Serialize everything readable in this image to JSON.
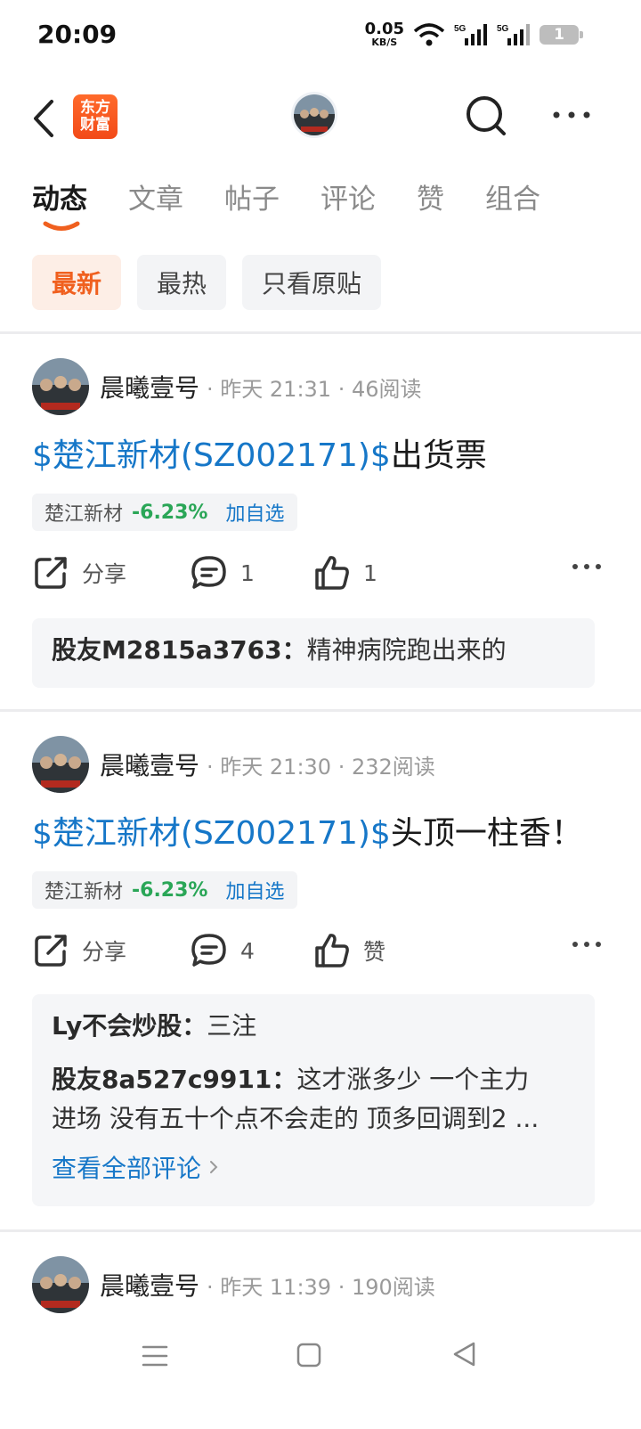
{
  "status_bar": {
    "time": "20:09",
    "net_speed": "0.05",
    "net_unit": "KB/S",
    "battery": "1",
    "signal_1": "5G",
    "signal_2": "5G"
  },
  "top_nav": {
    "logo_line1": "东方",
    "logo_line2": "财富"
  },
  "tabs": [
    "动态",
    "文章",
    "帖子",
    "评论",
    "赞",
    "组合"
  ],
  "filters": [
    "最新",
    "最热",
    "只看原贴"
  ],
  "posts": [
    {
      "author": "晨曦壹号",
      "meta": "· 昨天 21:31 · 46阅读",
      "stock_link": "$楚江新材(SZ002171)$",
      "text": "出货票",
      "stock_name": "楚江新材",
      "stock_change": "-6.23%",
      "add_watch": "加自选",
      "share_label": "分享",
      "comment_count": "1",
      "like_label": "1",
      "comments": [
        {
          "user": "股友M2815a3763：",
          "text": "精神病院跑出来的"
        }
      ]
    },
    {
      "author": "晨曦壹号",
      "meta": "· 昨天 21:30 · 232阅读",
      "stock_link": "$楚江新材(SZ002171)$",
      "text": "头顶一柱香！",
      "stock_name": "楚江新材",
      "stock_change": "-6.23%",
      "add_watch": "加自选",
      "share_label": "分享",
      "comment_count": "4",
      "like_label": "赞",
      "comments": [
        {
          "user": "Ly不会炒股：",
          "text": "三注"
        },
        {
          "user": "股友8a527c9911：",
          "text": "这才涨多少 一个主力",
          "text2": "进场 没有五十个点不会走的 顶多回调到2 ..."
        }
      ],
      "view_all": "查看全部评论"
    },
    {
      "author": "晨曦壹号",
      "meta": "· 昨天 11:39 · 190阅读"
    }
  ],
  "colors": {
    "accent": "#f0601f",
    "link": "#1677c8",
    "down": "#2aa657"
  }
}
